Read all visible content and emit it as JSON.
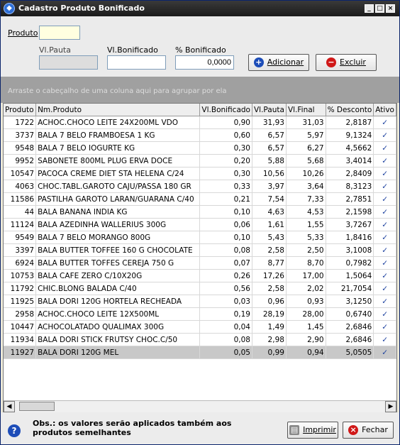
{
  "window": {
    "title": "Cadastro Produto Bonificado",
    "icon": "app-icon",
    "controls": [
      "minimize",
      "maximize",
      "close"
    ]
  },
  "form": {
    "produto_label": "Produto",
    "produto_value": "",
    "vlpauta_label": "Vl.Pauta",
    "vlpauta_value": "",
    "vlbonificado_label": "Vl.Bonificado",
    "vlbonificado_value": "",
    "pct_bonificado_label": "% Bonificado",
    "pct_bonificado_value": "0,0000",
    "adicionar_label": "Adicionar",
    "excluir_label": "Excluir"
  },
  "group_bar_text": "Arraste o cabeçalho de uma coluna aqui para agrupar por ela",
  "grid": {
    "columns": [
      "Produto",
      "Nm.Produto",
      "Vl.Bonificado",
      "Vl.Pauta",
      "Vl.Final",
      "% Desconto",
      "Ativo"
    ],
    "rows": [
      [
        "1722",
        "ACHOC.CHOCO LEITE 24X200ML VDO",
        "0,90",
        "31,93",
        "31,03",
        "2,8187",
        "✓"
      ],
      [
        "3737",
        "BALA 7 BELO FRAMBOESA 1 KG",
        "0,60",
        "6,57",
        "5,97",
        "9,1324",
        "✓"
      ],
      [
        "9548",
        "BALA 7 BELO IOGURTE KG",
        "0,30",
        "6,57",
        "6,27",
        "4,5662",
        "✓"
      ],
      [
        "9952",
        "SABONETE 800ML PLUG ERVA DOCE",
        "0,20",
        "5,88",
        "5,68",
        "3,4014",
        "✓"
      ],
      [
        "10547",
        "PACOCA CREME DIET STA HELENA C/24",
        "0,30",
        "10,56",
        "10,26",
        "2,8409",
        "✓"
      ],
      [
        "4063",
        "CHOC.TABL.GAROTO CAJU/PASSA 180 GR",
        "0,33",
        "3,97",
        "3,64",
        "8,3123",
        "✓"
      ],
      [
        "11586",
        "PASTILHA GAROTO LARAN/GUARANA C/40",
        "0,21",
        "7,54",
        "7,33",
        "2,7851",
        "✓"
      ],
      [
        "44",
        "BALA BANANA INDIA KG",
        "0,10",
        "4,63",
        "4,53",
        "2,1598",
        "✓"
      ],
      [
        "11124",
        "BALA AZEDINHA WALLERIUS 300G",
        "0,06",
        "1,61",
        "1,55",
        "3,7267",
        "✓"
      ],
      [
        "9549",
        "BALA 7 BELO MORANGO 800G",
        "0,10",
        "5,43",
        "5,33",
        "1,8416",
        "✓"
      ],
      [
        "3397",
        "BALA BUTTER TOFFEE 160 G CHOCOLATE",
        "0,08",
        "2,58",
        "2,50",
        "3,1008",
        "✓"
      ],
      [
        "6924",
        "BALA BUTTER TOFFES CEREJA 750 G",
        "0,07",
        "8,77",
        "8,70",
        "0,7982",
        "✓"
      ],
      [
        "10753",
        "BALA CAFE ZERO C/10X20G",
        "0,26",
        "17,26",
        "17,00",
        "1,5064",
        "✓"
      ],
      [
        "11792",
        "CHIC.BLONG BALADA C/40",
        "0,56",
        "2,58",
        "2,02",
        "21,7054",
        "✓"
      ],
      [
        "11925",
        "BALA DORI 120G HORTELA RECHEADA",
        "0,03",
        "0,96",
        "0,93",
        "3,1250",
        "✓"
      ],
      [
        "2958",
        "ACHOC.CHOCO LEITE 12X500ML",
        "0,19",
        "28,19",
        "28,00",
        "0,6740",
        "✓"
      ],
      [
        "10447",
        "ACHOCOLATADO QUALIMAX 300G",
        "0,04",
        "1,49",
        "1,45",
        "2,6846",
        "✓"
      ],
      [
        "11934",
        "BALA DORI STICK FRUTSY CHOC.C/50",
        "0,08",
        "2,98",
        "2,90",
        "2,6846",
        "✓"
      ],
      [
        "11927",
        "BALA DORI 120G MEL",
        "0,05",
        "0,99",
        "0,94",
        "5,0505",
        "✓"
      ]
    ],
    "selected_row": 18
  },
  "footer": {
    "obs_text": "Obs.: os valores serão aplicados também aos produtos semelhantes",
    "imprimir_label": "Imprimir",
    "fechar_label": "Fechar"
  },
  "colors": {
    "title_bg": "#1b1b1b",
    "group_bar": "#a0a0a0",
    "produto_field": "#ffffe0",
    "check": "#1a3f9e",
    "excluir_icon": "#d01818",
    "adicionar_icon": "#1d4db8"
  }
}
